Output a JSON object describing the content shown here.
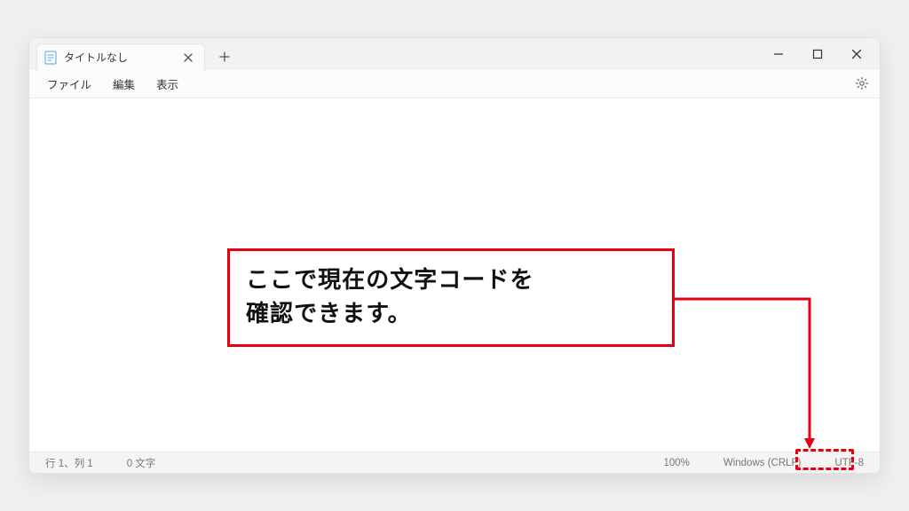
{
  "window": {
    "tab": {
      "title": "タイトルなし"
    },
    "menu": {
      "file": "ファイル",
      "edit": "編集",
      "view": "表示"
    },
    "status": {
      "position": "行 1、列 1",
      "chars": "0 文字",
      "zoom": "100%",
      "line_ending": "Windows (CRLF)",
      "encoding": "UTF-8"
    }
  },
  "annotation": {
    "line1": "ここで現在の文字コードを",
    "line2": "確認できます。"
  },
  "colors": {
    "accent_red": "#e60012"
  }
}
